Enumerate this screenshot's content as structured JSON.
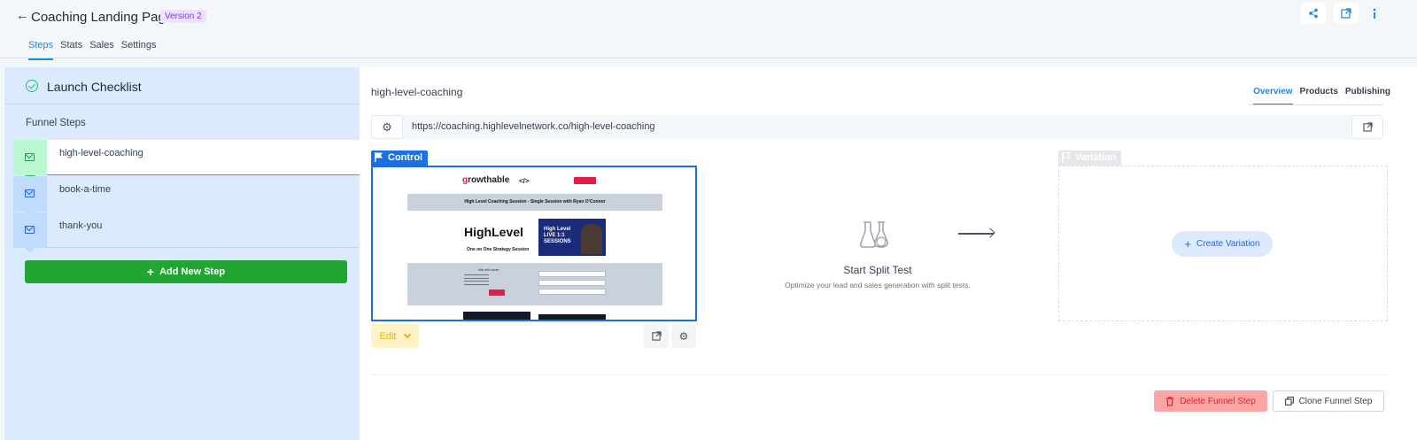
{
  "header": {
    "back_icon": "←",
    "title": "Coaching Landing Page",
    "version_badge": "Version 2",
    "tabs": [
      {
        "label": "Steps",
        "active": true
      },
      {
        "label": "Stats",
        "active": false
      },
      {
        "label": "Sales",
        "active": false
      },
      {
        "label": "Settings",
        "active": false
      }
    ],
    "action_icons": [
      "share-icon",
      "external-link-icon",
      "info-icon"
    ]
  },
  "sidebar": {
    "checklist_title": "Launch Checklist",
    "funnel_steps_label": "Funnel Steps",
    "steps": [
      {
        "name": "high-level-coaching",
        "active": true
      },
      {
        "name": "book-a-time",
        "active": false
      },
      {
        "name": "thank-you",
        "active": false
      }
    ],
    "add_step_label": "Add New Step",
    "add_step_icon": "+"
  },
  "main": {
    "step_title": "high-level-coaching",
    "tabs": [
      {
        "label": "Overview",
        "active": true
      },
      {
        "label": "Products",
        "active": false
      },
      {
        "label": "Publishing",
        "active": false
      }
    ],
    "url": "https://coaching.highlevelnetwork.co/high-level-coaching",
    "control_label": "Control",
    "variation_label": "Variation",
    "edit_label": "Edit",
    "split_test_title": "Start Split Test",
    "split_test_subtitle": "Optimize your lead and sales generation with split tests.",
    "create_variation_label": "Create Variation",
    "create_variation_icon": "+",
    "delete_label": "Delete Funnel Step",
    "clone_label": "Clone Funnel Step"
  },
  "preview": {
    "logo_prefix": "g",
    "logo_rest": "rowthable",
    "code_mark": "</>",
    "banner": "High Level Coaching Session - Single Session with Ryan O'Connor",
    "brand": "HighLevel",
    "brand_subtitle": "One on One Strategy Session",
    "video_text": "High Level LIVE 1:1 SESSIONS",
    "form_title": "We will cover"
  },
  "colors": {
    "accent": "#1e88e5",
    "control_blue": "#1e6fe0",
    "add_step_green": "#22a532",
    "delete_red": "#fda4a4",
    "sidebar_blue": "#dbeafe"
  }
}
